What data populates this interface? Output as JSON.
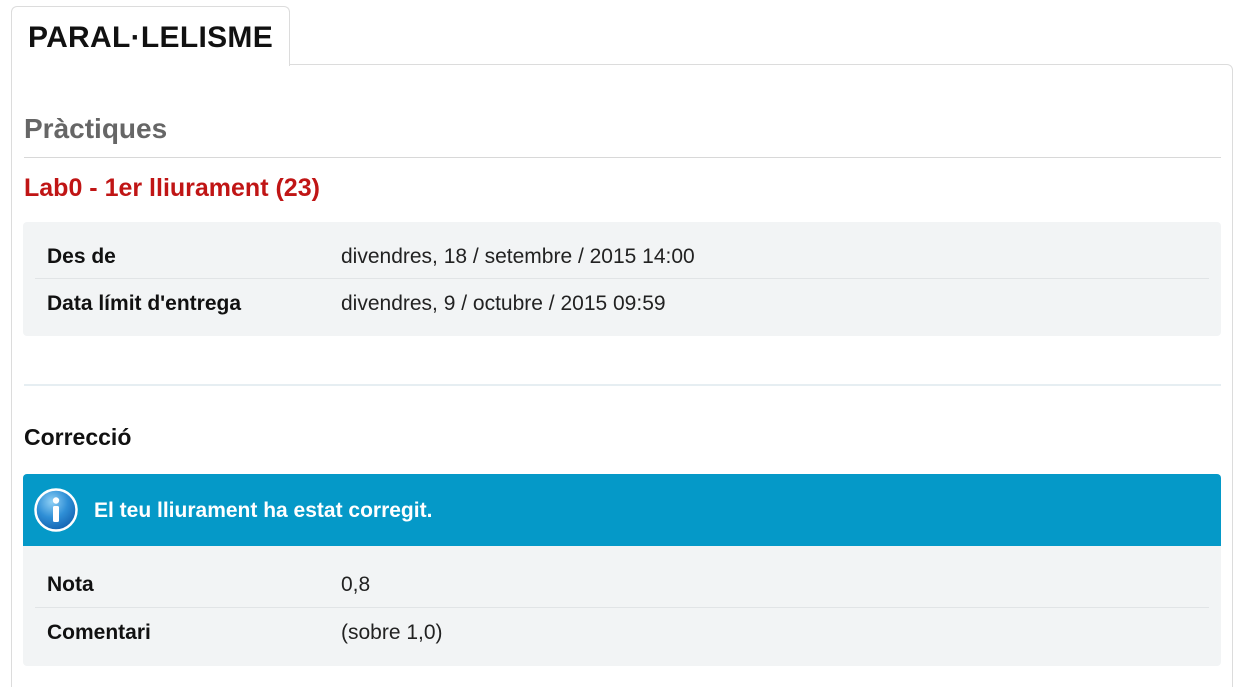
{
  "tab": {
    "title": "PARAL·LELISME"
  },
  "section": {
    "heading": "Pràctiques"
  },
  "assignment": {
    "title": "Lab0 - 1er lliurament (23)",
    "details": [
      {
        "label": "Des de",
        "value": "divendres, 18 / setembre / 2015 14:00"
      },
      {
        "label": "Data límit d'entrega",
        "value": "divendres, 9 / octubre / 2015 09:59"
      }
    ]
  },
  "correction": {
    "heading": "Correcció",
    "alert_icon": "info-icon",
    "alert_text": "El teu lliurament ha estat corregit.",
    "details": [
      {
        "label": "Nota",
        "value": "0,8"
      },
      {
        "label": "Comentari",
        "value": "(sobre 1,0)"
      }
    ]
  },
  "colors": {
    "assignment_title": "#c01515",
    "alert_background": "#0599c8",
    "info_box_background": "#f2f4f5"
  }
}
